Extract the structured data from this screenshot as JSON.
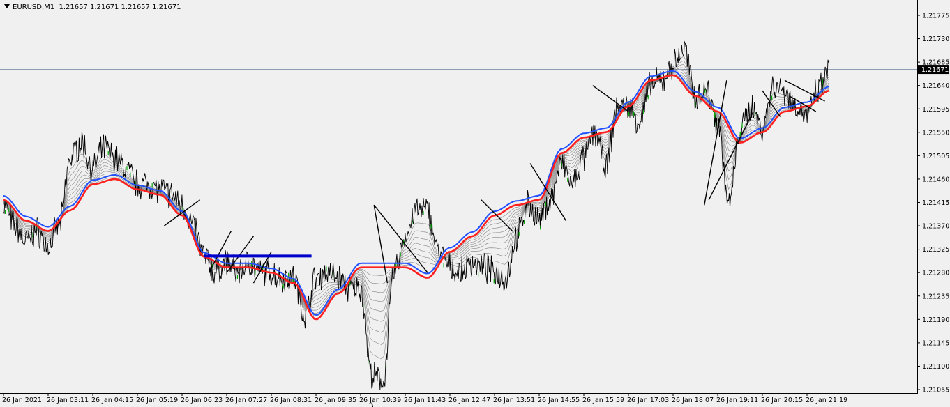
{
  "header": {
    "symbol": "EURUSD,M1",
    "ohlc": "1.21657 1.21671 1.21657 1.21671"
  },
  "current_price_label": "1.21671",
  "colors": {
    "background": "#f0f0f0",
    "price_line": "#000000",
    "ema_slow": "#ff2020",
    "ema_mid": "#2050ff",
    "ema_ribbon": "#555555",
    "trendlines": "#000000",
    "horizontal_level": "#0000cc",
    "bull_candles": "#00aa00"
  },
  "chart_data": {
    "type": "line",
    "title": "",
    "ylim": [
      1.21045,
      1.21805
    ],
    "yticks": [
      "1.21775",
      "1.21730",
      "1.21685",
      "1.21640",
      "1.21595",
      "1.21550",
      "1.21505",
      "1.21460",
      "1.21415",
      "1.21370",
      "1.21325",
      "1.21280",
      "1.21235",
      "1.21190",
      "1.21145",
      "1.21100",
      "1.21055"
    ],
    "xticks": [
      "26 Jan 2021",
      "26 Jan 03:11",
      "26 Jan 04:15",
      "26 Jan 05:19",
      "26 Jan 06:23",
      "26 Jan 07:27",
      "26 Jan 08:31",
      "26 Jan 09:35",
      "26 Jan 10:39",
      "26 Jan 11:43",
      "26 Jan 12:47",
      "26 Jan 13:51",
      "26 Jan 14:55",
      "26 Jan 15:59",
      "26 Jan 17:03",
      "26 Jan 18:07",
      "26 Jan 19:11",
      "26 Jan 20:15",
      "26 Jan 21:19"
    ],
    "current_price": 1.21671,
    "series": [
      {
        "type": "price",
        "x": [
          0,
          0.25,
          0.5,
          0.75,
          1,
          1.25,
          1.5,
          1.75,
          2,
          2.25,
          2.5,
          2.75,
          3,
          3.25,
          3.5,
          3.75,
          4,
          4.25,
          4.5,
          4.75,
          5,
          5.25,
          5.5,
          5.75,
          6,
          6.25,
          6.5,
          6.75,
          7,
          7.25,
          7.5,
          7.75,
          8,
          8.25,
          8.5,
          8.75,
          9,
          9.25,
          9.5,
          9.75,
          10,
          10.25,
          10.5,
          10.75,
          11,
          11.25,
          11.5,
          11.75,
          12,
          12.25,
          12.5,
          12.75,
          13,
          13.25,
          13.5,
          13.75,
          14,
          14.25,
          14.5,
          14.75,
          15,
          15.25,
          15.5,
          15.75,
          16,
          16.25,
          16.5,
          16.75,
          17,
          17.25,
          17.5,
          17.75,
          18,
          18.25,
          18.5
        ],
        "values": [
          1.2141,
          1.2137,
          1.2134,
          1.2136,
          1.2133,
          1.2137,
          1.215,
          1.2153,
          1.2148,
          1.2152,
          1.215,
          1.2148,
          1.2145,
          1.2145,
          1.2144,
          1.2143,
          1.2141,
          1.2137,
          1.2131,
          1.2128,
          1.213,
          1.2128,
          1.213,
          1.2128,
          1.2128,
          1.2127,
          1.2127,
          1.212,
          1.2127,
          1.2128,
          1.2127,
          1.2125,
          1.2125,
          1.2108,
          1.2107,
          1.2128,
          1.2135,
          1.214,
          1.214,
          1.2132,
          1.2129,
          1.2128,
          1.213,
          1.2129,
          1.2128,
          1.2127,
          1.2135,
          1.2141,
          1.2138,
          1.2142,
          1.2149,
          1.2145,
          1.215,
          1.2155,
          1.2148,
          1.216,
          1.216,
          1.2157,
          1.2164,
          1.2165,
          1.2168,
          1.2171,
          1.2162,
          1.2163,
          1.2157,
          1.2141,
          1.2155,
          1.216,
          1.2156,
          1.2164,
          1.2163,
          1.216,
          1.2158,
          1.2163,
          1.2167
        ]
      },
      {
        "type": "ema",
        "x": [
          0,
          0.5,
          1,
          1.5,
          2,
          2.5,
          3,
          3.5,
          4,
          4.5,
          5,
          5.5,
          6,
          6.5,
          7,
          7.5,
          8,
          8.5,
          9,
          9.5,
          10,
          10.5,
          11,
          11.5,
          12,
          12.5,
          13,
          13.5,
          14,
          14.5,
          15,
          15.5,
          16,
          16.5,
          17,
          17.5,
          18,
          18.5
        ],
        "values": [
          1.2142,
          1.2138,
          1.2136,
          1.214,
          1.2145,
          1.2146,
          1.2144,
          1.2143,
          1.2139,
          1.2131,
          1.2129,
          1.2129,
          1.2128,
          1.2126,
          1.2119,
          1.2124,
          1.2129,
          1.2129,
          1.2129,
          1.2127,
          1.2132,
          1.2135,
          1.2139,
          1.2141,
          1.2142,
          1.2151,
          1.2154,
          1.2155,
          1.216,
          1.2165,
          1.2166,
          1.2162,
          1.2159,
          1.2153,
          1.2155,
          1.2159,
          1.216,
          1.2163
        ]
      }
    ]
  }
}
